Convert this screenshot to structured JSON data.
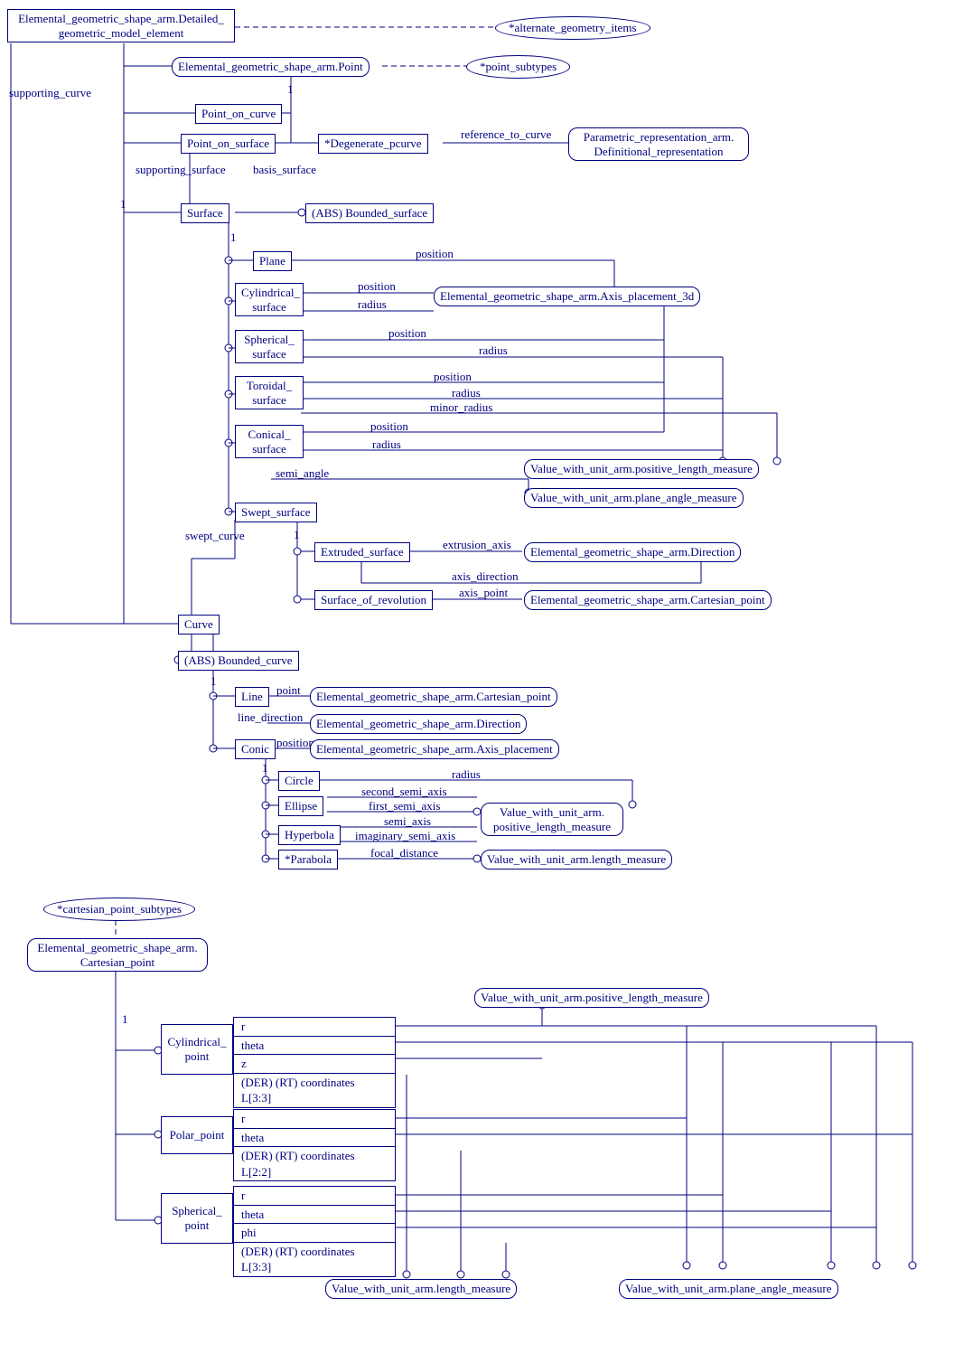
{
  "root": "Elemental_geometric_shape_arm.Detailed_\ngeometric_model_element",
  "alt_geo": "*alternate_geometry_items",
  "point": "Elemental_geometric_shape_arm.Point",
  "point_sub": "*point_subtypes",
  "poc": "Point_on_curve",
  "pos": "Point_on_surface",
  "deg_pcurve": "*Degenerate_pcurve",
  "param_rep": "Parametric_representation_arm.\nDefinitional_representation",
  "surface": "Surface",
  "bounded_surf": "(ABS) Bounded_surface",
  "plane": "Plane",
  "cyl_surf": "Cylindrical_\nsurface",
  "sph_surf": "Spherical_\nsurface",
  "tor_surf": "Toroidal_\nsurface",
  "con_surf": "Conical_\nsurface",
  "swept_surf": "Swept_surface",
  "extruded": "Extruded_surface",
  "sor": "Surface_of_revolution",
  "axis3d": "Elemental_geometric_shape_arm.Axis_placement_3d",
  "plm": "Value_with_unit_arm.positive_length_measure",
  "pam": "Value_with_unit_arm.plane_angle_measure",
  "dir": "Elemental_geometric_shape_arm.Direction",
  "cpt": "Elemental_geometric_shape_arm.Cartesian_point",
  "curve": "Curve",
  "bounded_curve": "(ABS) Bounded_curve",
  "line": "Line",
  "conic": "Conic",
  "circle": "Circle",
  "ellipse": "Ellipse",
  "hyperbola": "Hyperbola",
  "parabola": "*Parabola",
  "axis_place": "Elemental_geometric_shape_arm.Axis_placement",
  "plm2": "Value_with_unit_arm.\npositive_length_measure",
  "lm": "Value_with_unit_arm.length_measure",
  "cart_sub": "*cartesian_point_subtypes",
  "cart_root": "Elemental_geometric_shape_arm.\nCartesian_point",
  "cyl_pt": "Cylindrical_\npoint",
  "polar_pt": "Polar_point",
  "sph_pt": "Spherical_\npoint",
  "plm3": "Value_with_unit_arm.positive_length_measure",
  "lm3": "Value_with_unit_arm.length_measure",
  "pam3": "Value_with_unit_arm.plane_angle_measure",
  "lbl": {
    "supporting_curve": "supporting_curve",
    "supporting_surface": "supporting_surface",
    "basis_surface": "basis_surface",
    "ref_to_curve": "reference_to_curve",
    "position": "position",
    "radius": "radius",
    "minor_radius": "minor_radius",
    "semi_angle": "semi_angle",
    "swept_curve": "swept_curve",
    "extrusion_axis": "extrusion_axis",
    "axis_direction": "axis_direction",
    "axis_point": "axis_point",
    "point": "point",
    "line_direction": "line_direction",
    "second_semi": "second_semi_axis",
    "first_semi": "first_semi_axis",
    "semi_axis": "semi_axis",
    "imag_semi": "imaginary_semi_axis",
    "focal": "focal_distance",
    "r": "r",
    "theta": "theta",
    "z": "z",
    "phi": "phi",
    "coords33": "(DER) (RT) coordinates L[3:3]",
    "coords22": "(DER) (RT) coordinates L[2:2]",
    "one": "1"
  }
}
